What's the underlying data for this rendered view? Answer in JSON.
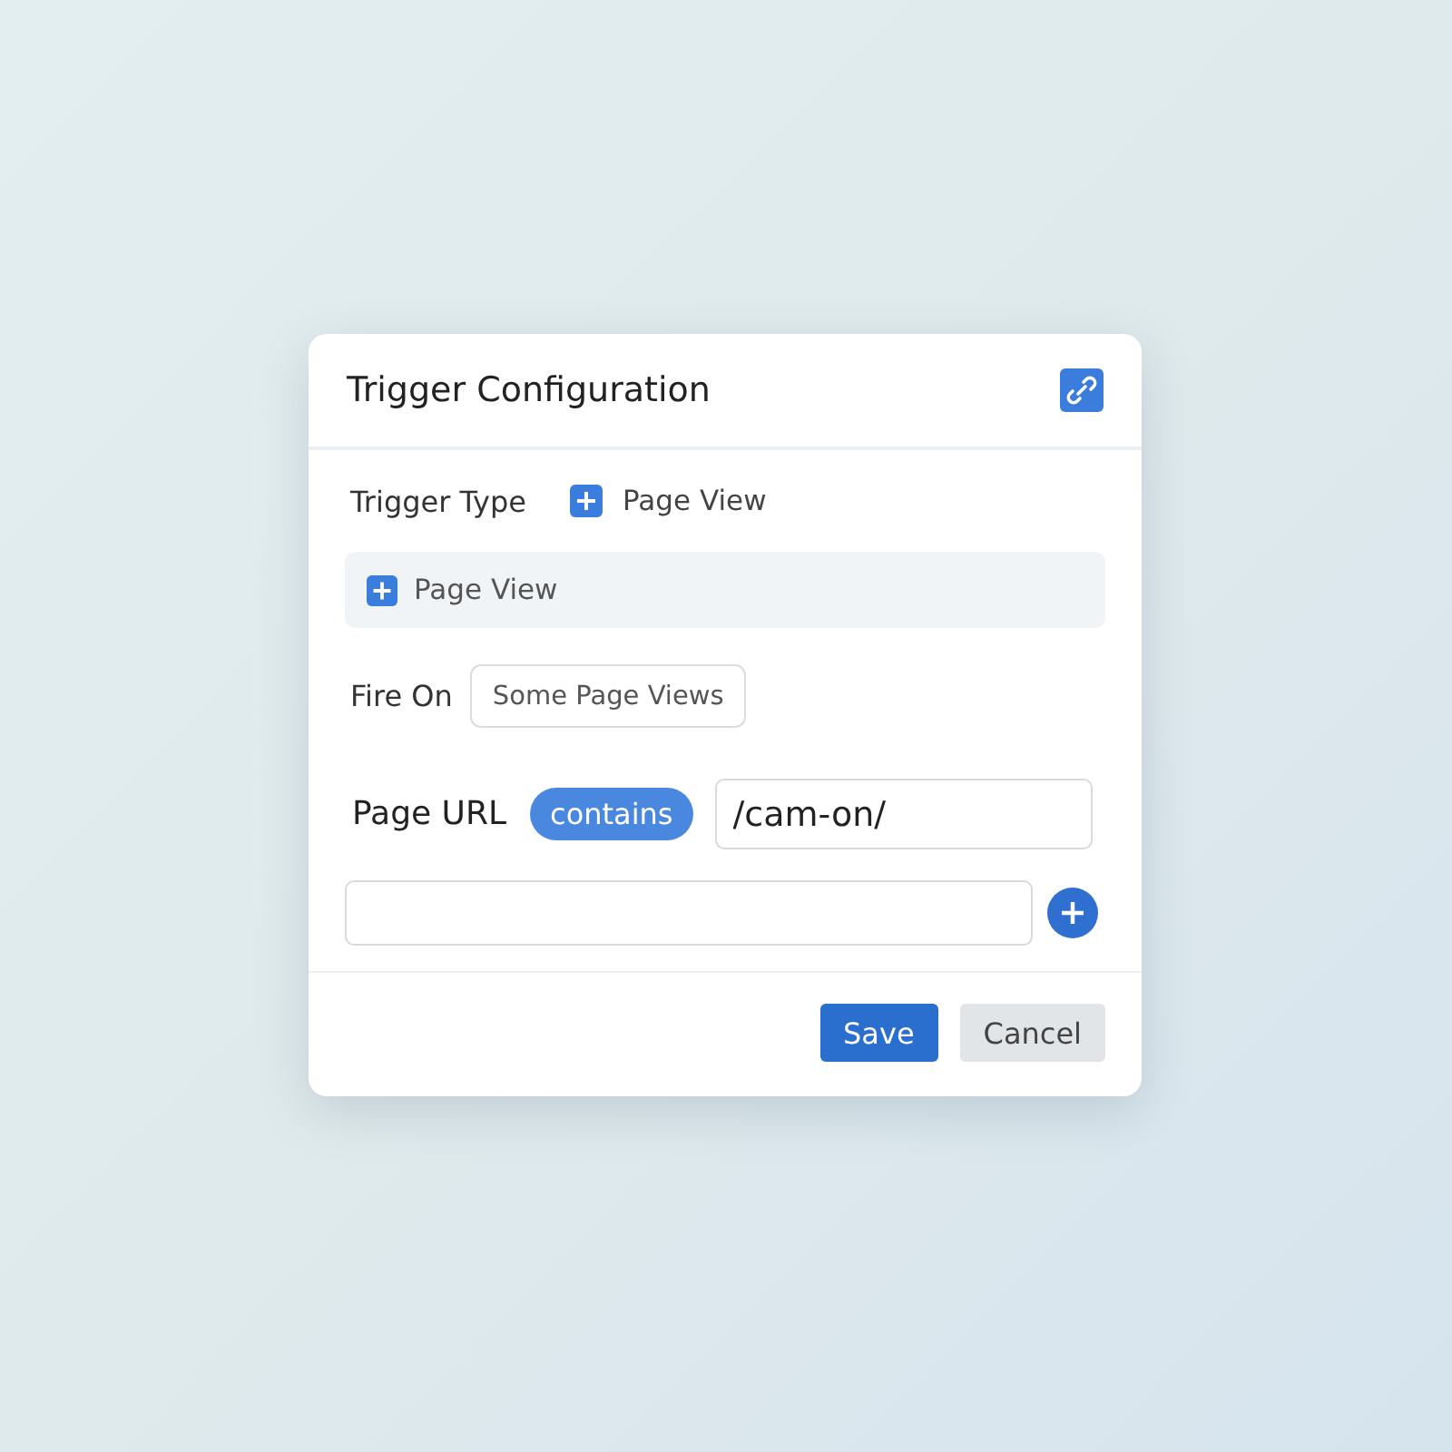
{
  "dialog": {
    "title": "Trigger Configuration"
  },
  "trigger_type": {
    "label": "Trigger Type",
    "value": "Page View"
  },
  "trigger_option": {
    "label": "Page View"
  },
  "fire_on": {
    "label": "Fire On",
    "value": "Some Page Views"
  },
  "condition": {
    "label": "Page URL",
    "operator": "contains",
    "value": "/cam-on/"
  },
  "buttons": [
    {
      "label": "Save",
      "kind": "primary"
    },
    {
      "label": "Cancel",
      "kind": "secondary"
    }
  ]
}
